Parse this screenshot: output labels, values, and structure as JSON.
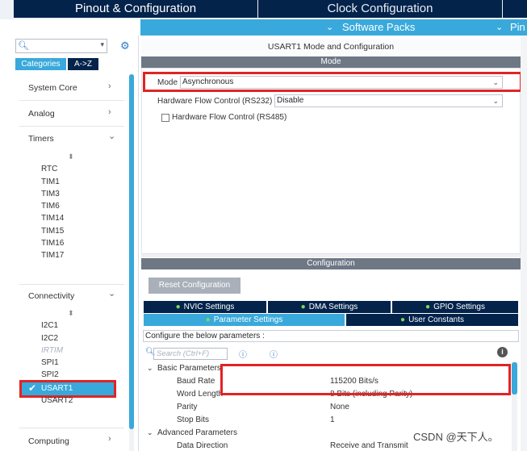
{
  "tabs": {
    "pinout": "Pinout & Configuration",
    "clock": "Clock Configuration",
    "pinout2": "Pin"
  },
  "software_packs": {
    "label": "Software Packs",
    "label2": "Pin",
    "chevron": "chevron-down-icon"
  },
  "sidebar": {
    "search_value": "",
    "category_tab": "Categories",
    "az_tab": "A->Z",
    "categories": [
      {
        "label": "System Core",
        "chevron": ">"
      },
      {
        "label": "Analog",
        "chevron": ">"
      },
      {
        "label": "Timers",
        "chevron": "v"
      },
      {
        "label": "Connectivity",
        "chevron": "v"
      },
      {
        "label": "Computing",
        "chevron": ">"
      }
    ],
    "timers_items": [
      "RTC",
      "TIM1",
      "TIM3",
      "TIM6",
      "TIM14",
      "TIM15",
      "TIM16",
      "TIM17"
    ],
    "connectivity_items": [
      "I2C1",
      "I2C2",
      "IRTIM",
      "SPI1",
      "SPI2",
      "USART1",
      "USART2"
    ],
    "selected_item": "USART1"
  },
  "main": {
    "title": "USART1 Mode and Configuration",
    "mode_header": "Mode",
    "mode_label": "Mode",
    "mode_value": "Asynchronous",
    "hw_flow_rs232_label": "Hardware Flow Control (RS232)",
    "hw_flow_rs232_value": "Disable",
    "hw_flow_rs485_label": "Hardware Flow Control (RS485)",
    "config_header": "Configuration",
    "reset_button": "Reset Configuration",
    "config_tabs": [
      {
        "label": "NVIC Settings",
        "active": false
      },
      {
        "label": "DMA Settings",
        "active": false
      },
      {
        "label": "GPIO Settings",
        "active": false
      },
      {
        "label": "Parameter Settings",
        "active": true
      },
      {
        "label": "User Constants",
        "active": false
      }
    ],
    "config_note": "Configure the below parameters :",
    "param_search_placeholder": "Search (Ctrl+F)",
    "basic_group": "Basic Parameters",
    "params": [
      {
        "name": "Baud Rate",
        "value": "115200 Bits/s"
      },
      {
        "name": "Word Length",
        "value": "8 Bits (including Parity)"
      },
      {
        "name": "Parity",
        "value": "None"
      },
      {
        "name": "Stop Bits",
        "value": "1"
      }
    ],
    "advanced_group": "Advanced Parameters",
    "advanced_params": [
      {
        "name": "Data Direction",
        "value": "Receive and Transmit"
      }
    ]
  },
  "watermark": "CSDN @天下人。",
  "colors": {
    "dark_navy": "#03234b",
    "accent_blue": "#39a9db",
    "highlight_red": "#e02424",
    "check_green": "#7ed957"
  }
}
